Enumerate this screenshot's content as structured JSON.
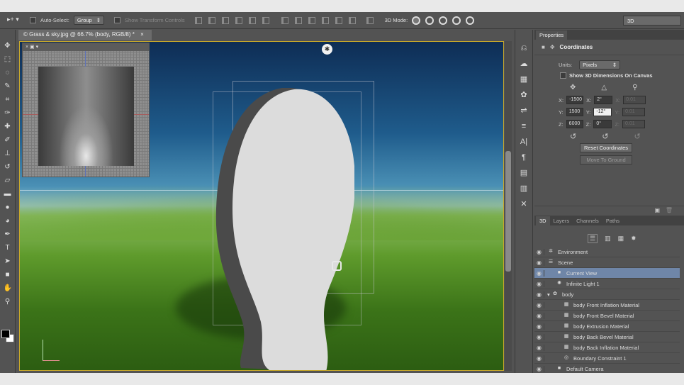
{
  "options_bar": {
    "tool_preset": "▸+ ▾",
    "auto_select_label": "Auto-Select:",
    "auto_select_value": "Group",
    "transform_controls_label": "Show Transform Controls",
    "mode_3d_label": "3D Mode:",
    "workspace": "3D"
  },
  "document": {
    "tab_title": "© Grass & sky.jpg @ 66.7% (body, RGB/8) *"
  },
  "properties": {
    "tab": "Properties",
    "section_title": "Coordinates",
    "units_label": "Units:",
    "units_value": "Pixels",
    "show_dims_label": "Show 3D Dimensions On Canvas",
    "position": {
      "x_label": "X:",
      "x": "-1500",
      "y_label": "Y:",
      "y": "1500",
      "z_label": "Z:",
      "z": "6000"
    },
    "rotation": {
      "x_label": "X:",
      "x": "2°",
      "y_label": "Y:",
      "y": "-12°",
      "z_label": "Z:",
      "z": "0°"
    },
    "scale": {
      "x_label": "X:",
      "x": "0.01",
      "y_label": "Y:",
      "y": "0.01",
      "z_label": "Z:",
      "z": "0.01"
    },
    "reset_button": "Reset Coordinates",
    "ground_button": "Move To Ground"
  },
  "panel3d": {
    "tabs": [
      "3D",
      "Layers",
      "Channels",
      "Paths"
    ],
    "rows": [
      {
        "label": "Environment",
        "icon": "✲"
      },
      {
        "label": "Scene",
        "icon": "☰"
      },
      {
        "label": "Current View",
        "icon": "■"
      },
      {
        "label": "Infinite Light 1",
        "icon": "✺"
      },
      {
        "label": "body",
        "icon": "✿"
      },
      {
        "label": "body Front Inflation Material",
        "icon": "▦"
      },
      {
        "label": "body Front Bevel Material",
        "icon": "▦"
      },
      {
        "label": "body Extrusion Material",
        "icon": "▦"
      },
      {
        "label": "body Back Bevel Material",
        "icon": "▦"
      },
      {
        "label": "body Back Inflation Material",
        "icon": "▦"
      },
      {
        "label": "Boundary Constraint 1",
        "icon": "◎"
      },
      {
        "label": "Default Camera",
        "icon": "■"
      }
    ]
  },
  "colors": {
    "accent": "#c9a92a",
    "selection": "#6f86a8",
    "panel": "#535353"
  }
}
